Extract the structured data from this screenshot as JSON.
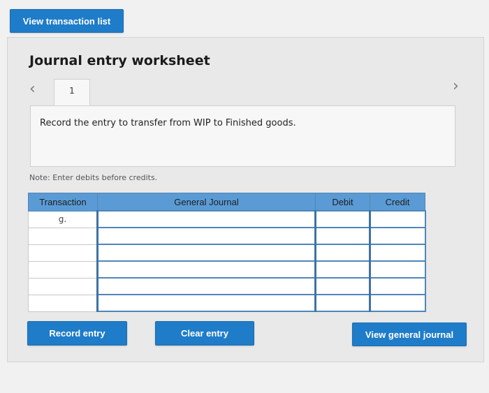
{
  "header": {
    "view_transactions_label": "View transaction list"
  },
  "worksheet": {
    "title": "Journal entry worksheet",
    "nav": {
      "prev_icon": "chevron-left-icon",
      "next_icon": "chevron-right-icon"
    },
    "tabs": [
      {
        "label": "1"
      }
    ],
    "instruction": "Record the entry to transfer from WIP to Finished goods.",
    "note": "Note: Enter debits before credits."
  },
  "table": {
    "columns": [
      "Transaction",
      "General Journal",
      "Debit",
      "Credit"
    ],
    "rows": [
      {
        "transaction": "g.",
        "account": "",
        "debit": "",
        "credit": ""
      },
      {
        "transaction": "",
        "account": "",
        "debit": "",
        "credit": ""
      },
      {
        "transaction": "",
        "account": "",
        "debit": "",
        "credit": ""
      },
      {
        "transaction": "",
        "account": "",
        "debit": "",
        "credit": ""
      },
      {
        "transaction": "",
        "account": "",
        "debit": "",
        "credit": ""
      },
      {
        "transaction": "",
        "account": "",
        "debit": "",
        "credit": ""
      }
    ]
  },
  "actions": {
    "record_label": "Record entry",
    "clear_label": "Clear entry",
    "view_journal_label": "View general journal"
  },
  "colors": {
    "accent": "#1f7cc9",
    "table_header": "#5b9bd5",
    "background": "#f1f1f1"
  }
}
